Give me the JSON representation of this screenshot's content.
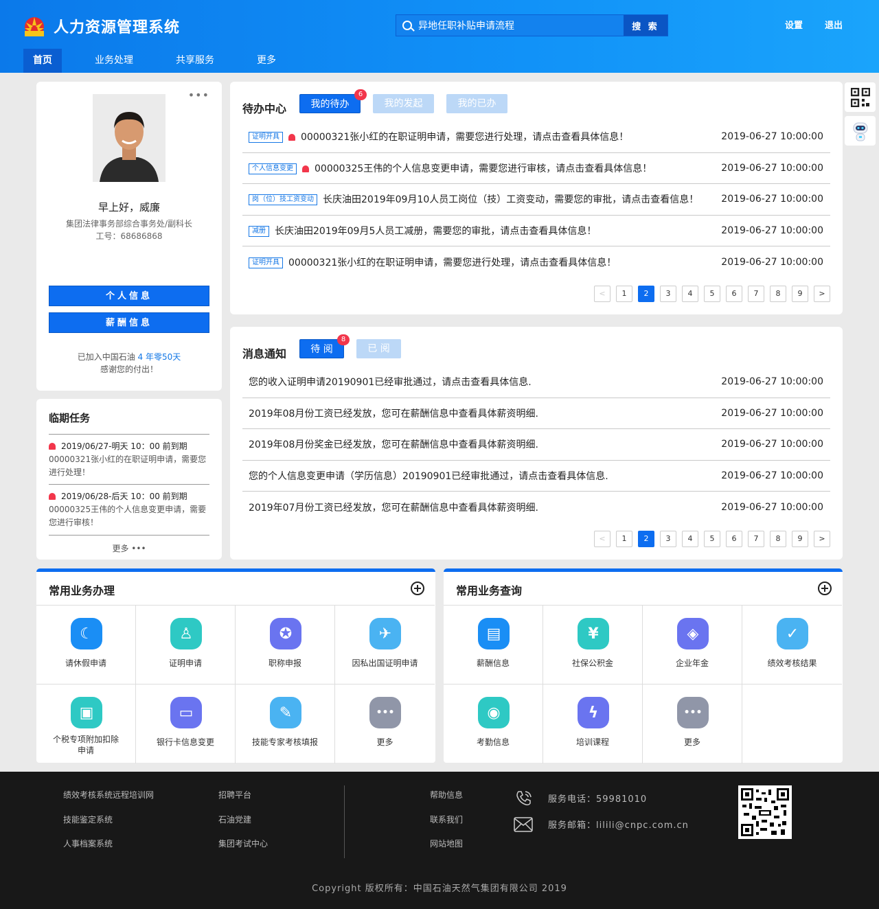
{
  "header": {
    "app_title": "人力资源管理系统",
    "search_value": "异地任职补贴申请流程",
    "search_button": "搜 索",
    "settings": "设置",
    "logout": "退出"
  },
  "nav": [
    "首页",
    "业务处理",
    "共享服务",
    "更多"
  ],
  "profile": {
    "greeting": "早上好，威廉",
    "dept": "集团法律事务部综合事务处/副科长",
    "emp_no": "工号：68686868",
    "btn_personal": "个人信息",
    "btn_salary": "薪酬信息",
    "joined_prefix": "已加入中国石油",
    "joined_years": "4 年零50天",
    "thanks": "感谢您的付出！"
  },
  "tasks": {
    "title": "临期任务",
    "items": [
      {
        "deadline": "2019/06/27-明天 10：00 前到期",
        "desc": "00000321张小红的在职证明申请，需要您进行处理！"
      },
      {
        "deadline": "2019/06/28-后天 10：00 前到期",
        "desc": "00000325王伟的个人信息变更申请，需要您进行审核！"
      }
    ],
    "more": "更多 •••"
  },
  "todo": {
    "title": "待办中心",
    "tabs": [
      "我的待办",
      "我的发起",
      "我的已办"
    ],
    "badge": "6",
    "rows": [
      {
        "tag": "证明开具",
        "bell": true,
        "text": "00000321张小红的在职证明申请，需要您进行处理，请点击查看具体信息！",
        "time": "2019-06-27 10:00:00"
      },
      {
        "tag": "个人信息变更",
        "bell": true,
        "text": "00000325王伟的个人信息变更申请，需要您进行审核，请点击查看具体信息！",
        "time": "2019-06-27 10:00:00"
      },
      {
        "tag": "岗（位）技工资变动",
        "bell": false,
        "text": "长庆油田2019年09月10人员工岗位（技）工资变动，需要您的审批，请点击查看信息！",
        "time": "2019-06-27 10:00:00"
      },
      {
        "tag": "减册",
        "bell": false,
        "text": "长庆油田2019年09月5人员工减册，需要您的审批，请点击查看具体信息！",
        "time": "2019-06-27 10:00:00"
      },
      {
        "tag": "证明开具",
        "bell": false,
        "text": "00000321张小红的在职证明申请，需要您进行处理，请点击查看具体信息！",
        "time": "2019-06-27 10:00:00"
      }
    ],
    "pages": [
      "1",
      "2",
      "3",
      "4",
      "5",
      "6",
      "7",
      "8",
      "9"
    ],
    "current_page": "2",
    "prev": "<",
    "next": ">"
  },
  "messages": {
    "title": "消息通知",
    "tabs": [
      "待 阅",
      "已 阅"
    ],
    "badge": "8",
    "rows": [
      {
        "text": "您的收入证明申请20190901已经审批通过，请点击查看具体信息.",
        "time": "2019-06-27 10:00:00"
      },
      {
        "text": "2019年08月份工资已经发放，您可在薪酬信息中查看具体薪资明细.",
        "time": "2019-06-27 10:00:00"
      },
      {
        "text": "2019年08月份奖金已经发放，您可在薪酬信息中查看具体薪资明细.",
        "time": "2019-06-27 10:00:00"
      },
      {
        "text": "您的个人信息变更申请（学历信息）20190901已经审批通过，请点击查看具体信息.",
        "time": "2019-06-27 10:00:00"
      },
      {
        "text": "2019年07月份工资已经发放，您可在薪酬信息中查看具体薪资明细.",
        "time": "2019-06-27 10:00:00"
      }
    ],
    "pages": [
      "1",
      "2",
      "3",
      "4",
      "5",
      "6",
      "7",
      "8",
      "9"
    ],
    "current_page": "2",
    "prev": "<",
    "next": ">"
  },
  "common_biz": {
    "title": "常用业务办理",
    "items": [
      {
        "label": "请休假申请",
        "icon": "moon-icon",
        "color": "#1a8ef5",
        "glyph": "☾"
      },
      {
        "label": "证明申请",
        "icon": "user-star-icon",
        "color": "#2ec9c4",
        "glyph": "♙"
      },
      {
        "label": "职称申报",
        "icon": "medal-icon",
        "color": "#6a74f0",
        "glyph": "✪"
      },
      {
        "label": "因私出国证明申请",
        "icon": "plane-icon",
        "color": "#4ab3f2",
        "glyph": "✈"
      },
      {
        "label": "个税专项附加扣除申请",
        "icon": "wallet-icon",
        "color": "#2ec9c4",
        "glyph": "▣"
      },
      {
        "label": "银行卡信息变更",
        "icon": "card-icon",
        "color": "#6a74f0",
        "glyph": "▭"
      },
      {
        "label": "技能专家考核填报",
        "icon": "edit-icon",
        "color": "#4ab3f2",
        "glyph": "✎"
      },
      {
        "label": "更多",
        "icon": "more-icon",
        "color": "#9096a8",
        "glyph": "•••"
      }
    ]
  },
  "common_query": {
    "title": "常用业务查询",
    "items": [
      {
        "label": "薪酬信息",
        "icon": "doc-icon",
        "color": "#1a8ef5",
        "glyph": "▤"
      },
      {
        "label": "社保公积金",
        "icon": "house-yen-icon",
        "color": "#2ec9c4",
        "glyph": "¥"
      },
      {
        "label": "企业年金",
        "icon": "layers-icon",
        "color": "#6a74f0",
        "glyph": "◈"
      },
      {
        "label": "绩效考核结果",
        "icon": "check-icon",
        "color": "#4ab3f2",
        "glyph": "✓"
      },
      {
        "label": "考勤信息",
        "icon": "location-icon",
        "color": "#2ec9c4",
        "glyph": "◉"
      },
      {
        "label": "培训课程",
        "icon": "charge-icon",
        "color": "#6a74f0",
        "glyph": "ϟ"
      },
      {
        "label": "更多",
        "icon": "more-icon",
        "color": "#9096a8",
        "glyph": "•••"
      }
    ]
  },
  "footer": {
    "col1": [
      "绩效考核系统远程培训网",
      "技能鉴定系统",
      "人事档案系统"
    ],
    "col2": [
      "招聘平台",
      "石油党建",
      "集团考试中心"
    ],
    "col3": [
      "帮助信息",
      "联系我们",
      "网站地图"
    ],
    "phone": "服务电话：59981010",
    "email": "服务邮箱：lilili@cnpc.com.cn",
    "copyright": "Copyright 版权所有：中国石油天然气集团有限公司 2019"
  }
}
